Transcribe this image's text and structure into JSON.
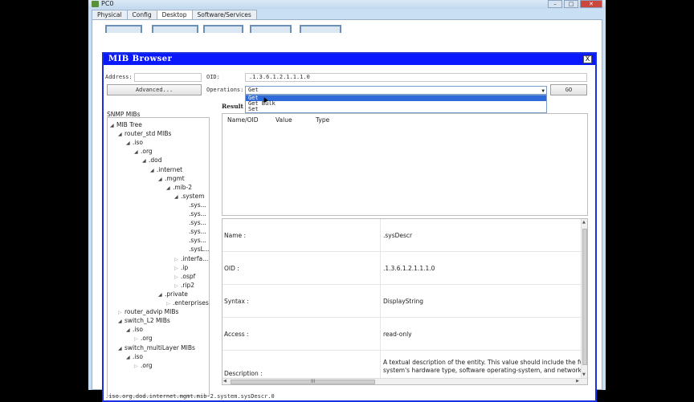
{
  "window": {
    "title": "PC0"
  },
  "tabs": [
    "Physical",
    "Config",
    "Desktop",
    "Software/Services"
  ],
  "mib_browser": {
    "title": "MIB Browser",
    "close_label": "X",
    "address_label": "Address:",
    "address_value": "",
    "oid_label": "OID:",
    "oid_value": ".1.3.6.1.2.1.1.1.0",
    "advanced_label": "Advanced...",
    "operations_label": "Operations:",
    "operations_selected": "Get",
    "operations_options": [
      "Get",
      "Get Bulk",
      "Set"
    ],
    "go_label": "GO",
    "result_label": "Result",
    "result_columns": [
      "Name/OID",
      "Value",
      "Type"
    ],
    "snmp_mibs_label": "SNMP MIBs",
    "tree": [
      {
        "label": "MIB Tree",
        "open": true
      },
      {
        "label": "router_std MIBs",
        "open": true
      },
      {
        "label": ".iso",
        "open": true
      },
      {
        "label": ".org",
        "open": true
      },
      {
        "label": ".dod",
        "open": true
      },
      {
        "label": ".internet",
        "open": true
      },
      {
        "label": ".mgmt",
        "open": true
      },
      {
        "label": ".mib-2",
        "open": true
      },
      {
        "label": ".system",
        "open": true
      },
      {
        "label": ".sys...",
        "open": null
      },
      {
        "label": ".sys...",
        "open": null
      },
      {
        "label": ".sys...",
        "open": null
      },
      {
        "label": ".sys...",
        "open": null
      },
      {
        "label": ".sys...",
        "open": null
      },
      {
        "label": ".sysL...",
        "open": null
      },
      {
        "label": ".interfa...",
        "open": false
      },
      {
        "label": ".ip",
        "open": false
      },
      {
        "label": ".ospf",
        "open": false
      },
      {
        "label": ".rip2",
        "open": false
      },
      {
        "label": ".private",
        "open": true
      },
      {
        "label": ".enterprises",
        "open": false
      },
      {
        "label": "router_advip MIBs",
        "open": false
      },
      {
        "label": "switch_L2 MIBs",
        "open": true
      },
      {
        "label": ".iso",
        "open": true
      },
      {
        "label": ".org",
        "open": false
      },
      {
        "label": "switch_multiLayer MIBs",
        "open": true
      },
      {
        "label": ".iso",
        "open": true
      },
      {
        "label": ".org",
        "open": false
      }
    ],
    "details": [
      {
        "key": "Name :",
        "value": ".sysDescr"
      },
      {
        "key": "OID :",
        "value": ".1.3.6.1.2.1.1.1.0"
      },
      {
        "key": "Syntax :",
        "value": "DisplayString"
      },
      {
        "key": "Access :",
        "value": "read-only"
      },
      {
        "key": "Description :",
        "value": "A textual description of the entity. This value should include the full",
        "value2": "system's hardware type, software operating-system, and networking"
      }
    ],
    "hscroll_grip": "III",
    "status_path": ".iso.org.dod.internet.mgmt.mib-2.system.sysDescr.0"
  }
}
